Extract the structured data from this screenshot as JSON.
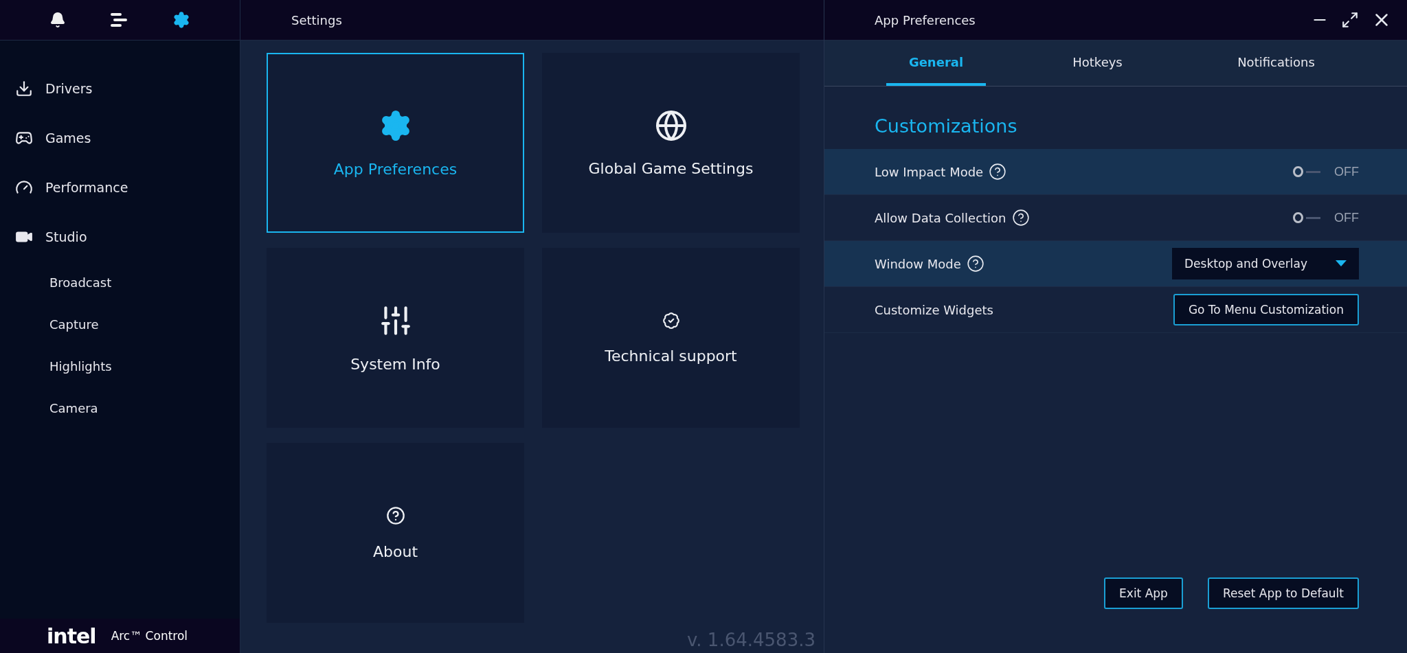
{
  "sidebar": {
    "top_icons": [
      {
        "kind": "bell",
        "selected": false
      },
      {
        "kind": "menu",
        "selected": false
      },
      {
        "kind": "gear",
        "selected": true
      }
    ],
    "nav": [
      {
        "label": "Drivers",
        "kind": "download"
      },
      {
        "label": "Games",
        "kind": "gamepad"
      },
      {
        "label": "Performance",
        "kind": "gauge"
      },
      {
        "label": "Studio",
        "kind": "video",
        "children": [
          {
            "label": "Broadcast"
          },
          {
            "label": "Capture"
          },
          {
            "label": "Highlights"
          },
          {
            "label": "Camera"
          }
        ]
      }
    ],
    "footer": {
      "logo": "intel",
      "product": "Arc™ Control"
    }
  },
  "settings": {
    "title": "Settings",
    "cards": [
      {
        "label": "App Preferences",
        "kind": "gear",
        "selected": true
      },
      {
        "label": "Global Game Settings",
        "kind": "globe-gear",
        "selected": false
      },
      {
        "label": "System Info",
        "kind": "sliders",
        "selected": false
      },
      {
        "label": "Technical support",
        "kind": "support",
        "selected": false
      },
      {
        "label": "About",
        "kind": "question",
        "selected": false
      }
    ],
    "version": "v. 1.64.4583.3"
  },
  "preferences": {
    "title": "App Preferences",
    "tabs": [
      {
        "label": "General",
        "selected": true
      },
      {
        "label": "Hotkeys",
        "selected": false
      },
      {
        "label": "Notifications",
        "selected": false
      }
    ],
    "section": "Customizations",
    "rows": [
      {
        "kind": "toggle",
        "label": "Low Impact Mode",
        "help": true,
        "on": false,
        "state_text": "OFF"
      },
      {
        "kind": "toggle",
        "label": "Allow Data Collection",
        "help": true,
        "on": false,
        "state_text": "OFF"
      },
      {
        "kind": "dropdown",
        "label": "Window Mode",
        "help": true,
        "value": "Desktop and Overlay"
      },
      {
        "kind": "button",
        "label": "Customize Widgets",
        "help": false,
        "button": "Go To Menu Customization"
      }
    ],
    "buttons": [
      "Exit App",
      "Reset App to Default"
    ]
  }
}
